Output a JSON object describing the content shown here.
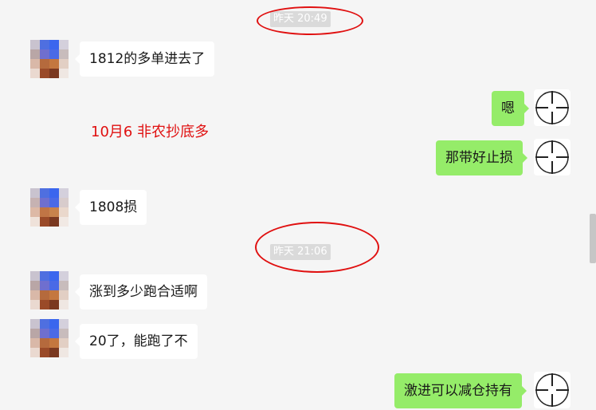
{
  "chat": {
    "timestamps": [
      "昨天 20:49",
      "昨天 21:06"
    ],
    "messages": {
      "m1": "1812的多单进去了",
      "m2": "嗯",
      "m3": "那带好止损",
      "m4": "1808损",
      "m5": "涨到多少跑合适啊",
      "m6": "20了，能跑了不",
      "m7": "激进可以减仓持有"
    },
    "annotation": "10月6 非农抄底多"
  },
  "colors": {
    "background": "#f5f5f5",
    "bubble_incoming": "#ffffff",
    "bubble_outgoing": "#95ec69",
    "annotation_red": "#e01010",
    "timestamp_bg": "#dadada"
  },
  "icons": {
    "contact_avatar": "pixelated-avatar",
    "own_avatar": "crosshair-icon"
  }
}
